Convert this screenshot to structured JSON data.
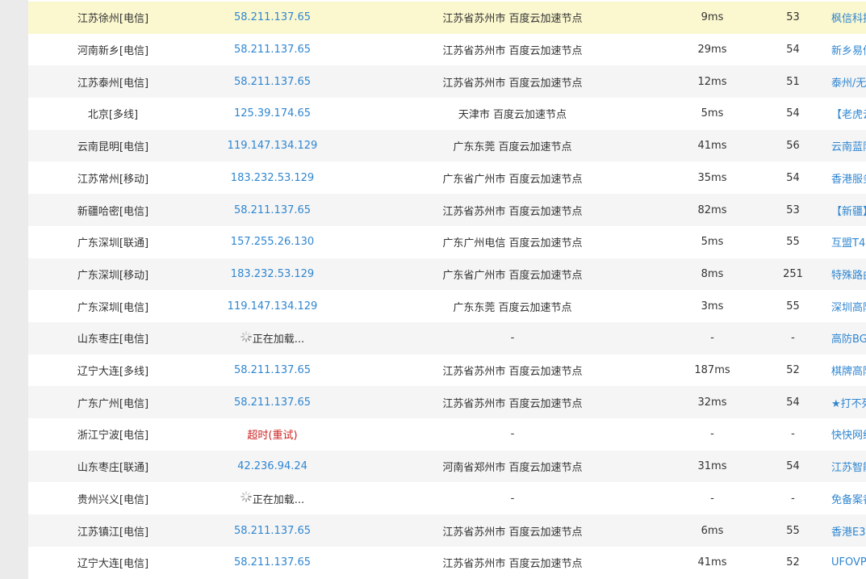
{
  "rows": [
    {
      "loc": "江苏徐州[电信]",
      "ip": "58.211.137.65",
      "addr": "江苏省苏州市 百度云加速节点",
      "ms": "9ms",
      "ttl": "53",
      "isp": "枫信科技",
      "state": "ok",
      "highlight": true
    },
    {
      "loc": "河南新乡[电信]",
      "ip": "58.211.137.65",
      "addr": "江苏省苏州市 百度云加速节点",
      "ms": "29ms",
      "ttl": "54",
      "isp": "新乡易信",
      "state": "ok"
    },
    {
      "loc": "江苏泰州[电信]",
      "ip": "58.211.137.65",
      "addr": "江苏省苏州市 百度云加速节点",
      "ms": "12ms",
      "ttl": "51",
      "isp": "泰州/无锡",
      "state": "ok"
    },
    {
      "loc": "北京[多线]",
      "ip": "125.39.174.65",
      "addr": "天津市 百度云加速节点",
      "ms": "5ms",
      "ttl": "54",
      "isp": "【老虎云",
      "state": "ok"
    },
    {
      "loc": "云南昆明[电信]",
      "ip": "119.147.134.129",
      "addr": "广东东莞 百度云加速节点",
      "ms": "41ms",
      "ttl": "56",
      "isp": "云南蓝队",
      "state": "ok"
    },
    {
      "loc": "江苏常州[移动]",
      "ip": "183.232.53.129",
      "addr": "广东省广州市 百度云加速节点",
      "ms": "35ms",
      "ttl": "54",
      "isp": "香港服务",
      "state": "ok"
    },
    {
      "loc": "新疆哈密[电信]",
      "ip": "58.211.137.65",
      "addr": "江苏省苏州市 百度云加速节点",
      "ms": "82ms",
      "ttl": "53",
      "isp": "【新疆】",
      "state": "ok"
    },
    {
      "loc": "广东深圳[联通]",
      "ip": "157.255.26.130",
      "addr": "广东广州电信 百度云加速节点",
      "ms": "5ms",
      "ttl": "55",
      "isp": "互盟T4",
      "state": "ok"
    },
    {
      "loc": "广东深圳[移动]",
      "ip": "183.232.53.129",
      "addr": "广东省广州市 百度云加速节点",
      "ms": "8ms",
      "ttl": "251",
      "isp": "特殊路由",
      "state": "ok"
    },
    {
      "loc": "广东深圳[电信]",
      "ip": "119.147.134.129",
      "addr": "广东东莞 百度云加速节点",
      "ms": "3ms",
      "ttl": "55",
      "isp": "深圳高防",
      "state": "ok"
    },
    {
      "loc": "山东枣庄[电信]",
      "ip": "正在加载...",
      "addr": "-",
      "ms": "-",
      "ttl": "-",
      "isp": "高防BGP",
      "state": "loading"
    },
    {
      "loc": "辽宁大连[多线]",
      "ip": "58.211.137.65",
      "addr": "江苏省苏州市 百度云加速节点",
      "ms": "187ms",
      "ttl": "52",
      "isp": "棋牌高防",
      "state": "ok"
    },
    {
      "loc": "广东广州[电信]",
      "ip": "58.211.137.65",
      "addr": "江苏省苏州市 百度云加速节点",
      "ms": "32ms",
      "ttl": "54",
      "isp": "★打不死",
      "state": "ok"
    },
    {
      "loc": "浙江宁波[电信]",
      "ip": "超时",
      "retry": "(重试)",
      "addr": "-",
      "ms": "-",
      "ttl": "-",
      "isp": "快快网络",
      "state": "timeout"
    },
    {
      "loc": "山东枣庄[联通]",
      "ip": "42.236.94.24",
      "addr": "河南省郑州市 百度云加速节点",
      "ms": "31ms",
      "ttl": "54",
      "isp": "江苏智能",
      "state": "ok"
    },
    {
      "loc": "贵州兴义[电信]",
      "ip": "正在加载...",
      "addr": "-",
      "ms": "-",
      "ttl": "-",
      "isp": "免备案香",
      "state": "loading"
    },
    {
      "loc": "江苏镇江[电信]",
      "ip": "58.211.137.65",
      "addr": "江苏省苏州市 百度云加速节点",
      "ms": "6ms",
      "ttl": "55",
      "isp": "香港E3",
      "state": "ok"
    },
    {
      "loc": "辽宁大连[电信]",
      "ip": "58.211.137.65",
      "addr": "江苏省苏州市 百度云加速节点",
      "ms": "41ms",
      "ttl": "52",
      "isp": "UFOVPS",
      "state": "ok"
    }
  ]
}
